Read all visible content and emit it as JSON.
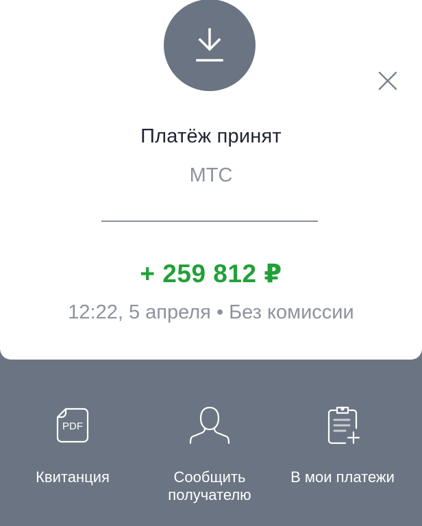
{
  "payment": {
    "title": "Платёж принят",
    "recipient": "МТС",
    "amount": "+ 259 812 ₽",
    "details": "12:22, 5 апреля • Без комиссии"
  },
  "actions": {
    "receipt": {
      "label": "Квитанция",
      "icon_text": "PDF"
    },
    "notify": {
      "label_line1": "Сообщить",
      "label_line2": "получателю"
    },
    "add_to_payments": {
      "label": "В мои платежи"
    }
  },
  "colors": {
    "background": "#6b7482",
    "card": "#ffffff",
    "amount": "#21a038",
    "title": "#1e2530",
    "secondary": "#8d939c"
  },
  "icons": [
    "download-icon",
    "close-icon",
    "pdf-icon",
    "person-icon",
    "clipboard-add-icon"
  ]
}
